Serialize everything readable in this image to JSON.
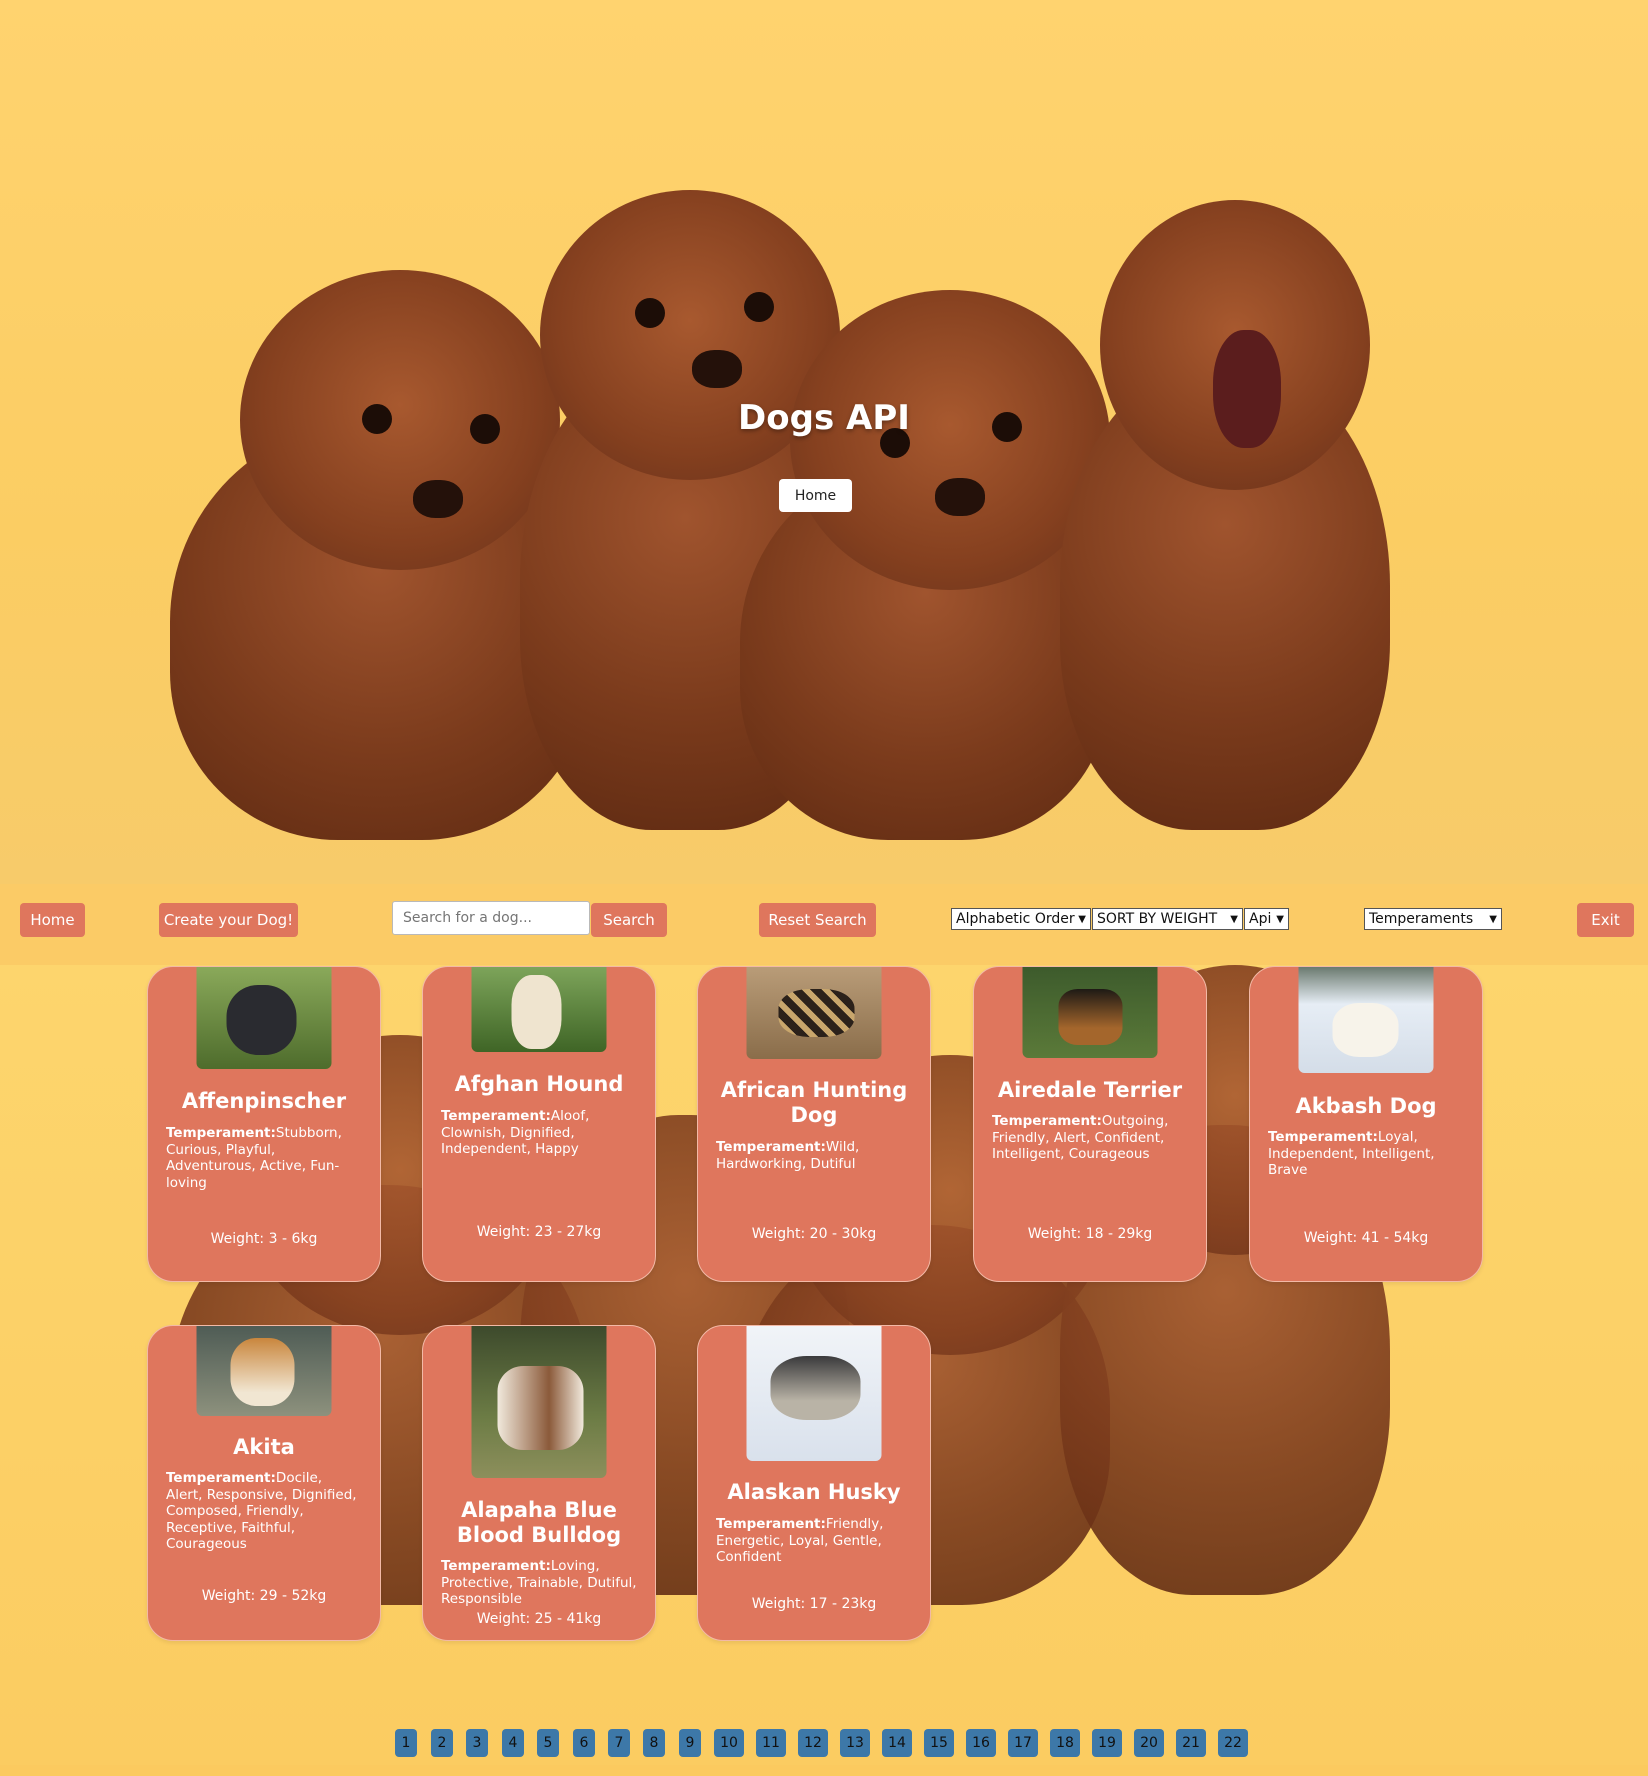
{
  "hero": {
    "title": "Dogs API",
    "home_label": "Home"
  },
  "nav": {
    "home_label": "Home",
    "create_label": "Create your Dog!",
    "search_placeholder": "Search for a dog...",
    "search_label": "Search",
    "reset_label": "Reset Search",
    "order_select": "Alphabetic Order",
    "weight_select": "SORT BY WEIGHT",
    "source_select": "Api",
    "temperament_select": "Temperaments",
    "exit_label": "Exit"
  },
  "temperament_label": "Temperament:",
  "cards": [
    {
      "name": "Affenpinscher",
      "temperament": "Stubborn, Curious, Playful, Adventurous, Active, Fun-loving",
      "weight": "Weight: 3 - 6kg",
      "photo_color": "#6f8c3f"
    },
    {
      "name": "Afghan Hound",
      "temperament": "Aloof, Clownish, Dignified, Independent, Happy",
      "weight": "Weight: 23 - 27kg",
      "photo_color": "#4f7a34"
    },
    {
      "name": "African Hunting Dog",
      "temperament": "Wild, Hardworking, Dutiful",
      "weight": "Weight: 20 - 30kg",
      "photo_color": "#9a7b57"
    },
    {
      "name": "Airedale Terrier",
      "temperament": "Outgoing, Friendly, Alert, Confident, Intelligent, Courageous",
      "weight": "Weight: 18 - 29kg",
      "photo_color": "#3f5a2e"
    },
    {
      "name": "Akbash Dog",
      "temperament": "Loyal, Independent, Intelligent, Brave",
      "weight": "Weight: 41 - 54kg",
      "photo_color": "#dfe6ee"
    },
    {
      "name": "Akita",
      "temperament": "Docile, Alert, Responsive, Dignified, Composed, Friendly, Receptive, Faithful, Courageous",
      "weight": "Weight: 29 - 52kg",
      "photo_color": "#7a7f6a"
    },
    {
      "name": "Alapaha Blue Blood Bulldog",
      "temperament": "Loving, Protective, Trainable, Dutiful, Responsible",
      "weight": "Weight: 25 - 41kg",
      "photo_color": "#5f6b3c"
    },
    {
      "name": "Alaskan Husky",
      "temperament": "Friendly, Energetic, Loyal, Gentle, Confident",
      "weight": "Weight: 17 - 23kg",
      "photo_color": "#e8edf4"
    }
  ],
  "pages": [
    "1",
    "2",
    "3",
    "4",
    "5",
    "6",
    "7",
    "8",
    "9",
    "10",
    "11",
    "12",
    "13",
    "14",
    "15",
    "16",
    "17",
    "18",
    "19",
    "20",
    "21",
    "22"
  ],
  "colors": {
    "accent": "#df765d",
    "background": "#fdd26a",
    "page_button": "#3d78a8"
  }
}
